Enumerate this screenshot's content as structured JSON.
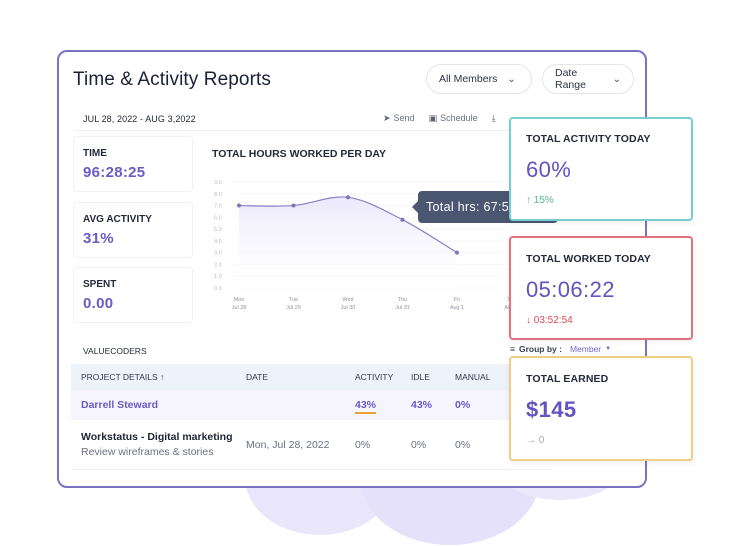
{
  "header": {
    "title": "Time & Activity Reports",
    "members_filter": "All Members",
    "date_range_filter": "Date Range"
  },
  "toolbar": {
    "date_range": "JUL 28, 2022 - AUG 3,2022",
    "send_label": "Send",
    "schedule_label": "Schedule"
  },
  "stats": [
    {
      "label": "TIME",
      "value": "96:28:25"
    },
    {
      "label": "AVG ACTIVITY",
      "value": "31%"
    },
    {
      "label": "SPENT",
      "value": "0.00"
    }
  ],
  "chart_data": {
    "type": "line",
    "title": "TOTAL HOURS WORKED PER DAY",
    "xlabel": "",
    "ylabel": "",
    "categories": [
      {
        "day": "Mon",
        "date": "Jul 28"
      },
      {
        "day": "Tue",
        "date": "Jul 29"
      },
      {
        "day": "Wed",
        "date": "Jul 30"
      },
      {
        "day": "Thu",
        "date": "Jul 31"
      },
      {
        "day": "Fri",
        "date": "Aug 1"
      },
      {
        "day": "Sat",
        "date": "Aug 2"
      }
    ],
    "values": [
      7.0,
      7.0,
      7.7,
      5.8,
      3.0,
      null
    ],
    "yticks": [
      "0.0",
      "1.0",
      "2.0",
      "3.0",
      "4.0",
      "5.0",
      "6.0",
      "7.0",
      "8.0",
      "9.0"
    ],
    "ylim": [
      0,
      9
    ],
    "grid": true,
    "area_fill": true,
    "tooltip": "Total hrs: 67:5"
  },
  "cards": {
    "activity": {
      "label": "TOTAL ACTIVITY TODAY",
      "value": "60%",
      "delta": "↑ 15%"
    },
    "worked": {
      "label": "TOTAL WORKED TODAY",
      "value": "05:06:22",
      "delta": "↓ 03:52:54"
    },
    "earned": {
      "label": "TOTAL EARNED",
      "value": "$145",
      "delta": "→ 0"
    }
  },
  "table": {
    "org": "VALUECODERS",
    "group_by_label": "Group by :",
    "group_by_value": "Member",
    "columns": [
      "PROJECT DETAILS ↑",
      "DATE",
      "ACTIVITY",
      "IDLE",
      "MANUAL"
    ],
    "member_row": {
      "name": "Darrell Steward",
      "date": "",
      "activity": "43%",
      "idle": "43%",
      "manual": "0%"
    },
    "rows": [
      {
        "project": "Workstatus - Digital marketing",
        "task": "Review wireframes & stories",
        "date": "Mon, Jul 28, 2022",
        "activity": "0%",
        "idle": "0%",
        "manual": "0%"
      }
    ]
  }
}
